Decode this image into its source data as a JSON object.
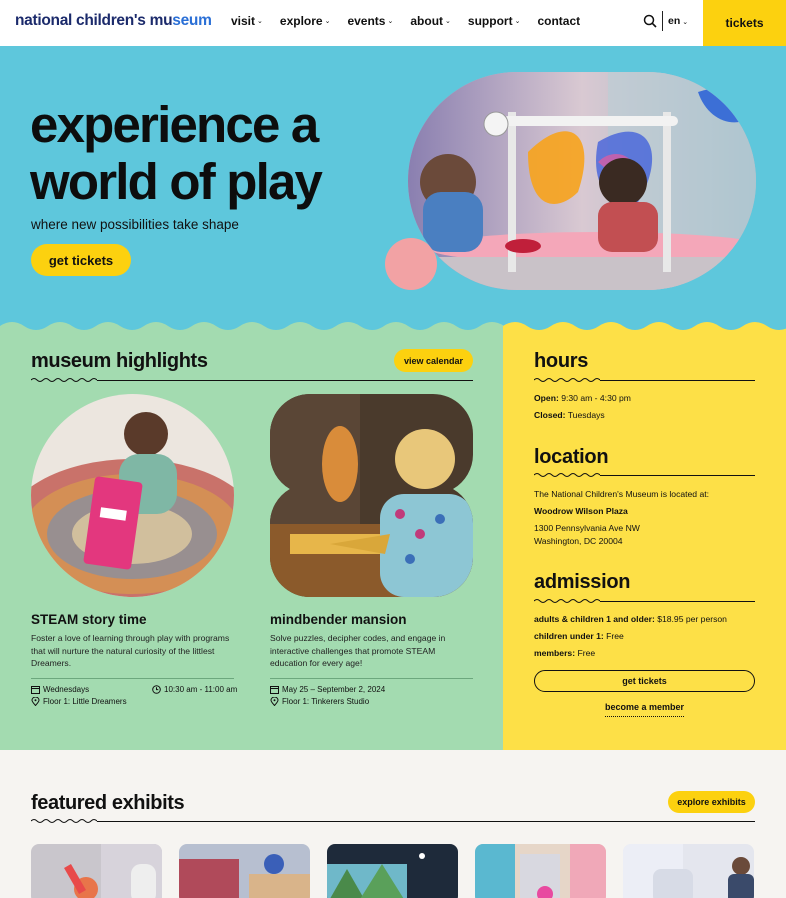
{
  "nav": {
    "logo_main": "national children's mu",
    "logo_accent": "seum",
    "links": [
      {
        "label": "visit",
        "chevron": true
      },
      {
        "label": "explore",
        "chevron": true
      },
      {
        "label": "events",
        "chevron": true
      },
      {
        "label": "about",
        "chevron": true
      },
      {
        "label": "support",
        "chevron": true
      },
      {
        "label": "contact",
        "chevron": false
      }
    ],
    "language": "en",
    "tickets_label": "tickets"
  },
  "hero": {
    "title_line1": "experience a",
    "title_line2": "world of play",
    "subtitle": "where new possibilities take shape",
    "button_label": "get tickets"
  },
  "highlights": {
    "title": "museum highlights",
    "calendar_label": "view calendar",
    "cards": [
      {
        "title": "STEAM story time",
        "description": "Foster a love of learning through play with programs that will nurture the natural curiosity of the littlest Dreamers.",
        "date": "Wednesdays",
        "time": "10:30 am - 11:00 am",
        "location": "Floor 1: Little Dreamers"
      },
      {
        "title": "mindbender mansion",
        "description": "Solve puzzles, decipher codes, and engage in interactive challenges that promote STEAM education for every age!",
        "date": "May 25 – September 2, 2024",
        "location": "Floor 1: Tinkerers Studio"
      }
    ]
  },
  "info": {
    "hours_title": "hours",
    "open_label": "Open:",
    "open_value": "9:30 am - 4:30 pm",
    "closed_label": "Closed:",
    "closed_value": "Tuesdays",
    "location_title": "location",
    "location_intro": "The National Children's Museum is located at:",
    "location_place": "Woodrow Wilson Plaza",
    "address_line1": "1300 Pennsylvania Ave NW",
    "address_line2": "Washington, DC 20004",
    "admission_title": "admission",
    "adult_label": "adults & children 1 and older:",
    "adult_value": "$18.95 per person",
    "under1_label": "children under 1:",
    "under1_value": "Free",
    "members_label": "members:",
    "members_value": "Free",
    "tickets_button": "get tickets",
    "member_link": "become a member"
  },
  "featured": {
    "title": "featured exhibits",
    "explore_label": "explore exhibits"
  },
  "colors": {
    "hero_bg": "#5ec7dc",
    "highlights_bg": "#a3dbb0",
    "info_bg": "#fde047",
    "accent_yellow": "#fcd10f",
    "page_bg": "#f6f4f1"
  }
}
